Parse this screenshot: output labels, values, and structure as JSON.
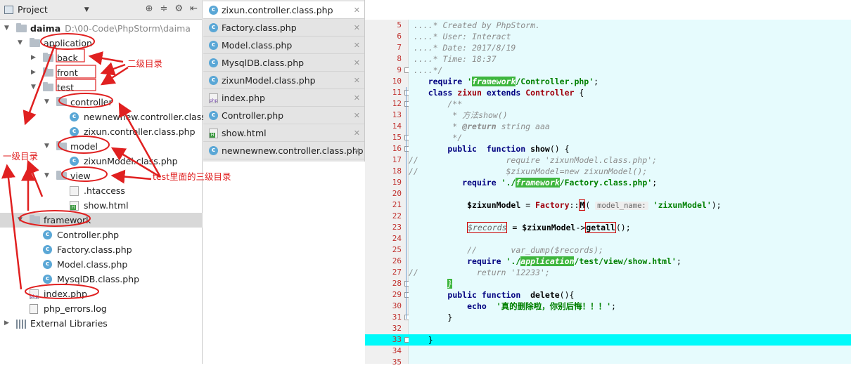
{
  "panel": {
    "title": "Project",
    "tree": [
      {
        "label": "daima",
        "path": "D:\\00-Code\\PhpStorm\\daima",
        "icon": "folder-icon",
        "depth": 0,
        "open": true
      },
      {
        "label": "application",
        "icon": "folder-icon",
        "depth": 1,
        "open": true
      },
      {
        "label": "back",
        "icon": "folder-icon",
        "depth": 2,
        "open": false
      },
      {
        "label": "front",
        "icon": "folder-icon",
        "depth": 2,
        "open": false
      },
      {
        "label": "test",
        "icon": "folder-icon",
        "depth": 2,
        "open": true
      },
      {
        "label": "controller",
        "icon": "folder-icon",
        "depth": 3,
        "open": true
      },
      {
        "label": "newnewnew.controller.class.p",
        "icon": "php-class-icon",
        "depth": 4
      },
      {
        "label": "zixun.controller.class.php",
        "icon": "php-class-icon",
        "depth": 4
      },
      {
        "label": "model",
        "icon": "folder-icon",
        "depth": 3,
        "open": true
      },
      {
        "label": "zixunModel.class.php",
        "icon": "php-class-icon",
        "depth": 4
      },
      {
        "label": "view",
        "icon": "folder-icon",
        "depth": 3,
        "open": true
      },
      {
        "label": ".htaccess",
        "icon": "htaccess-icon",
        "depth": 4
      },
      {
        "label": "show.html",
        "icon": "html-file-icon",
        "depth": 4
      },
      {
        "label": "framework",
        "icon": "folder-icon",
        "depth": 1,
        "open": true,
        "selected": true
      },
      {
        "label": "Controller.php",
        "icon": "php-class-icon",
        "depth": 2
      },
      {
        "label": "Factory.class.php",
        "icon": "php-class-icon",
        "depth": 2
      },
      {
        "label": "Model.class.php",
        "icon": "php-class-icon",
        "depth": 2
      },
      {
        "label": "MysqlDB.class.php",
        "icon": "php-class-icon",
        "depth": 2
      },
      {
        "label": "index.php",
        "icon": "php-file-icon",
        "depth": 1
      },
      {
        "label": "php_errors.log",
        "icon": "log-file-icon",
        "depth": 1
      },
      {
        "label": "External Libraries",
        "icon": "library-icon",
        "depth": 0,
        "open": false
      }
    ]
  },
  "tabs": [
    {
      "label": "zixun.controller.class.php",
      "icon": "php-class-icon",
      "active": true
    },
    {
      "label": "Factory.class.php",
      "icon": "php-class-icon"
    },
    {
      "label": "Model.class.php",
      "icon": "php-class-icon"
    },
    {
      "label": "MysqlDB.class.php",
      "icon": "php-class-icon"
    },
    {
      "label": "zixunModel.class.php",
      "icon": "php-class-icon"
    },
    {
      "label": "index.php",
      "icon": "php-file-icon"
    },
    {
      "label": "Controller.php",
      "icon": "php-class-icon"
    },
    {
      "label": "show.html",
      "icon": "html-file-icon"
    },
    {
      "label": "newnewnew.controller.class.php",
      "icon": "php-class-icon"
    }
  ],
  "code": [
    {
      "n": "5",
      "html": "<span class='cm'> ....* Created by PhpStorm.</span>"
    },
    {
      "n": "6",
      "html": "<span class='cm'> ....* User: Interact</span>"
    },
    {
      "n": "7",
      "html": "<span class='cm'> ....* Date: 2017/8/19</span>"
    },
    {
      "n": "8",
      "html": "<span class='cm'> ....* Time: 18:37</span>"
    },
    {
      "n": "9",
      "html": "<span class='cm'> ....*/</span>"
    },
    {
      "n": "10",
      "html": "    <span class='kw'>require</span> <span class='str'>'<span class='hl'>framework</span>/Controller.php'</span>;"
    },
    {
      "n": "11",
      "html": "    <span class='kw'>class</span> <span class='cls'>zixun</span> <span class='kw'>extends</span> <span class='cls'>Controller</span> {"
    },
    {
      "n": "12",
      "html": "<span class='cm'>        /**</span>"
    },
    {
      "n": "13",
      "html": "<span class='cm'>         * 方法show()</span>"
    },
    {
      "n": "14",
      "html": "<span class='cm'>         * <b>@return</b> string aaa</span>"
    },
    {
      "n": "15",
      "html": "<span class='cm'>         */</span>"
    },
    {
      "n": "16",
      "html": "        <span class='kw'>public</span>  <span class='kw'>function</span> <span class='var'>show</span>() {"
    },
    {
      "n": "17",
      "html": "<span class='cm'>//                  require 'zixunModel.class.php';</span>"
    },
    {
      "n": "18",
      "html": "<span class='cm'>//                  $zixunModel=new zixunModel();</span>"
    },
    {
      "n": "19",
      "html": "           <span class='kw'>require</span> <span class='str'>'./<span class='hl'>framework</span>/Factory.class.php'</span>;"
    },
    {
      "n": "20",
      "html": ""
    },
    {
      "n": "21",
      "html": "            <span class='var'>$zixunModel</span> = <span class='cls'>Factory</span>::<span class='box'><b>M</b></span>( <span class='hint'>model_name:</span> <span class='str'>'zixunModel'</span>);"
    },
    {
      "n": "22",
      "html": ""
    },
    {
      "n": "23",
      "html": "            <span class='box'><i style='color:#666'>$records</i></span> = <span class='var'>$zixunModel</span>-><span class='box'><b>getall</b></span>();"
    },
    {
      "n": "24",
      "html": ""
    },
    {
      "n": "25",
      "html": "<span class='cm'>            //       var_dump($records);</span>"
    },
    {
      "n": "26",
      "html": "            <span class='kw'>require</span> <span class='str'>'./<span class='hl'>application</span>/test/view/show.html'</span>;"
    },
    {
      "n": "27",
      "html": "<span class='cm'>//            return '12233';</span>"
    },
    {
      "n": "28",
      "html": "        <span class='hl'>}</span>"
    },
    {
      "n": "29",
      "html": "        <span class='kw'>public</span> <span class='kw'>function</span>  <span class='var'>delete</span>(){"
    },
    {
      "n": "30",
      "html": "            <span class='kw'>echo</span>  <span class='str'>'真的删除啦，你别后悔！！！'</span>;"
    },
    {
      "n": "31",
      "html": "        }"
    },
    {
      "n": "32",
      "html": ""
    },
    {
      "n": "33",
      "html": "    }",
      "current": true
    },
    {
      "n": "34",
      "html": ""
    },
    {
      "n": "35",
      "html": ""
    }
  ],
  "annotations": {
    "second_level": "二级目录",
    "first_level": "一级目录",
    "third_level": "test里面的三级目录"
  }
}
